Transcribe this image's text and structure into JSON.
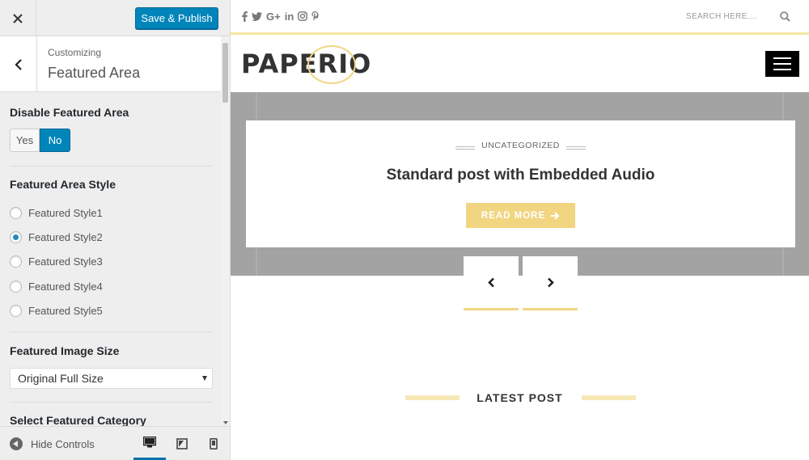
{
  "customizer": {
    "save_label": "Save & Publish",
    "section_sub": "Customizing",
    "section_title": "Featured Area",
    "disable_featured": {
      "label": "Disable Featured Area",
      "yes": "Yes",
      "no": "No",
      "selected": "No"
    },
    "style": {
      "label": "Featured Area Style",
      "options": [
        "Featured Style1",
        "Featured Style2",
        "Featured Style3",
        "Featured Style4",
        "Featured Style5"
      ],
      "selected": "Featured Style2"
    },
    "image_size": {
      "label": "Featured Image Size",
      "value": "Original Full Size"
    },
    "category": {
      "label": "Select Featured Category"
    },
    "hide_controls": "Hide Controls",
    "accent_color": "#0085ba"
  },
  "site": {
    "search_placeholder": "SEARCH HERE....",
    "logo": "PAPERIO",
    "slide": {
      "category": "UNCATEGORIZED",
      "title": "Standard post with Embedded Audio",
      "read_more": "READ MORE"
    },
    "latest_heading": "LATEST POST",
    "accent_color": "#f1d581",
    "social_icons": [
      "facebook-icon",
      "twitter-icon",
      "google-plus-icon",
      "linkedin-icon",
      "instagram-icon",
      "pinterest-icon"
    ]
  }
}
